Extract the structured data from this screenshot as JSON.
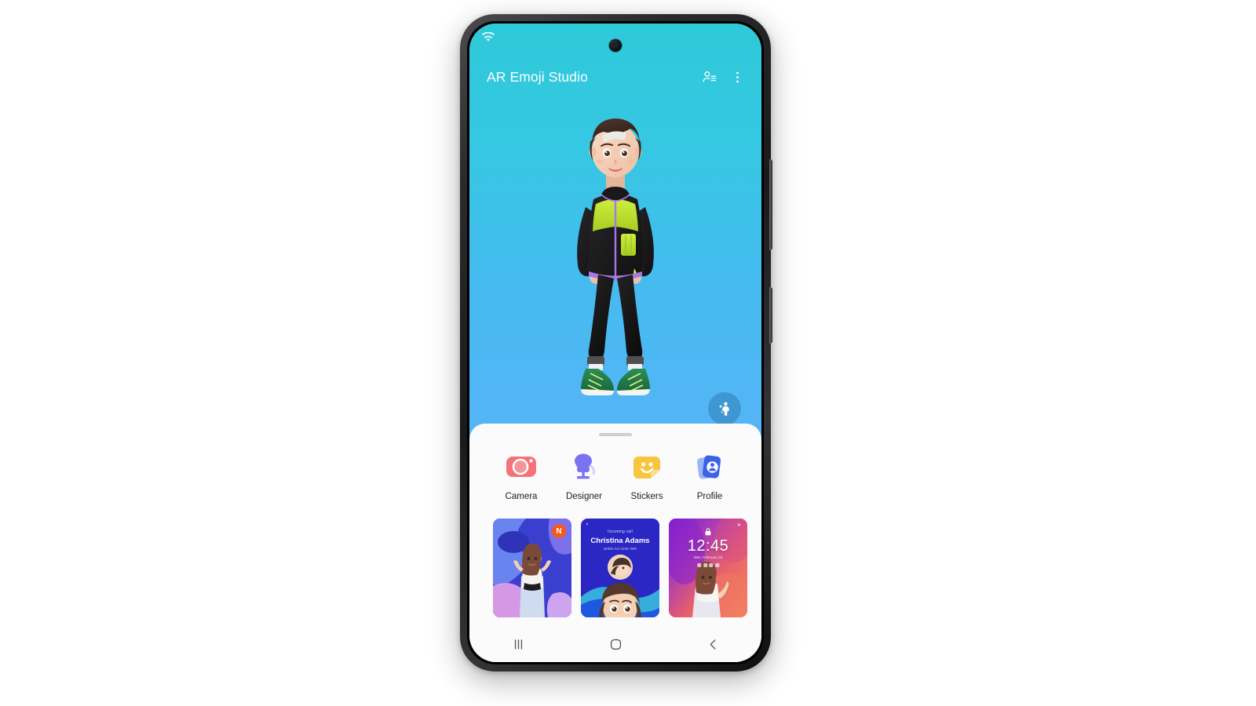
{
  "app": {
    "title": "AR Emoji Studio"
  },
  "status_bar": {
    "wifi_icon": "wifi-icon"
  },
  "app_bar": {
    "contacts_icon": "person-list-icon",
    "overflow_icon": "more-vertical-icon"
  },
  "avatar_stage": {
    "fab_icon": "avatar-sparkle-icon",
    "background_top_color": "#2ec9d9",
    "background_bottom_color": "#56b4f7",
    "character": {
      "hair_color": "#3d2a23",
      "headband_color": "#ece9e4",
      "jacket_color": "#1c1b1c",
      "jacket_accent_color": "#c4e63a",
      "jacket_trim_color": "#a679e8",
      "pants_color": "#1b1a1b",
      "shoe_color": "#1f7a4a",
      "skin_color": "#f3cdb4"
    }
  },
  "sheet": {
    "handle": "drag-handle",
    "actions": [
      {
        "label": "Camera",
        "icon": "camera-icon",
        "color": "#f4737a"
      },
      {
        "label": "Designer",
        "icon": "mannequin-icon",
        "color": "#7b72f0"
      },
      {
        "label": "Stickers",
        "icon": "sticker-icon",
        "color": "#f8c53f"
      },
      {
        "label": "Profile",
        "icon": "profile-cards-icon",
        "color": "#3b63e8"
      }
    ],
    "cards": [
      {
        "name": "wallpaper-card",
        "badge": "N",
        "badge_color": "#f4581f"
      },
      {
        "name": "call-screen-card",
        "incoming_label": "Incoming call",
        "caller_name": "Christina Adams",
        "caller_number": "Mobile  012-3456-7890"
      },
      {
        "name": "lock-screen-card",
        "time": "12:45",
        "date": "Mon, February 28",
        "lock_icon": "lock-icon"
      }
    ]
  },
  "nav_bar": {
    "recents": "recents-icon",
    "home": "home-icon",
    "back": "back-icon"
  }
}
